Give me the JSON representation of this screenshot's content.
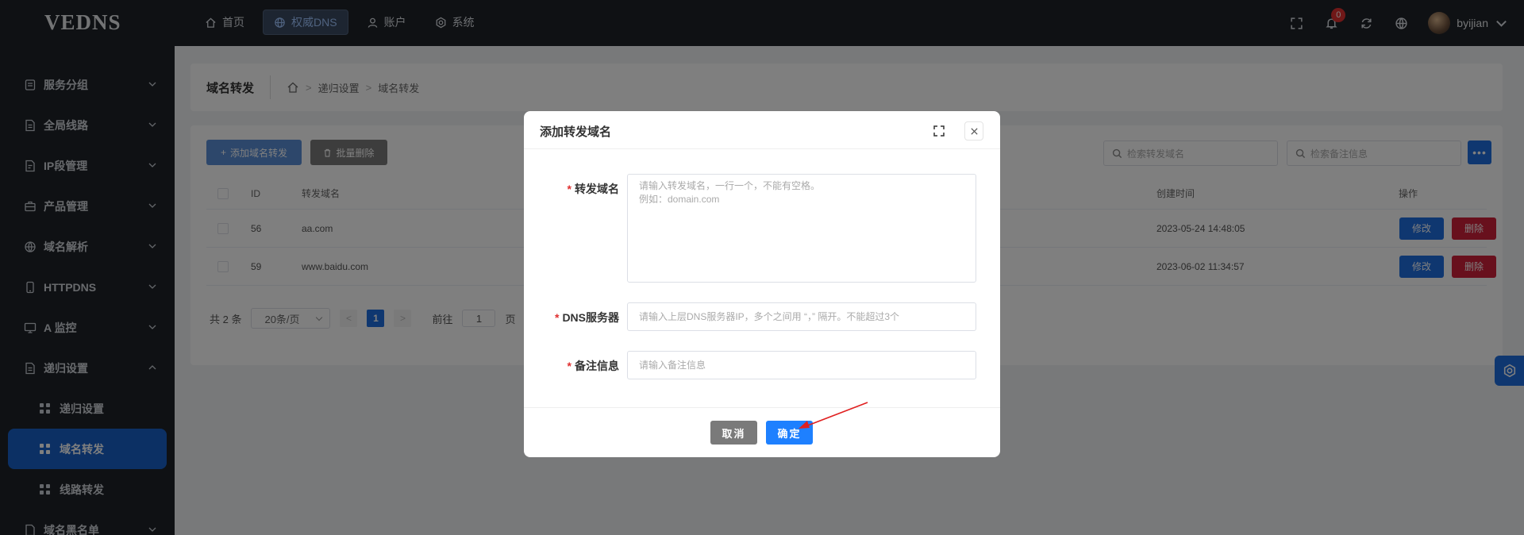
{
  "app": {
    "logo": "VEDNS"
  },
  "topnav": {
    "items": [
      {
        "label": "首页",
        "icon": "home-icon",
        "active": false
      },
      {
        "label": "权威DNS",
        "icon": "globe-icon",
        "active": true
      },
      {
        "label": "账户",
        "icon": "user-icon",
        "active": false
      },
      {
        "label": "系统",
        "icon": "gear-icon",
        "active": false
      }
    ]
  },
  "topright": {
    "notification_count": "0",
    "username": "byijian"
  },
  "sidebar": {
    "items": [
      {
        "label": "服务分组"
      },
      {
        "label": "全局线路"
      },
      {
        "label": "IP段管理"
      },
      {
        "label": "产品管理"
      },
      {
        "label": "域名解析"
      },
      {
        "label": "HTTPDNS"
      },
      {
        "label": "A 监控"
      },
      {
        "label": "递归设置"
      }
    ],
    "sub_items": [
      {
        "label": "递归设置",
        "active": false
      },
      {
        "label": "域名转发",
        "active": true
      },
      {
        "label": "线路转发",
        "active": false
      }
    ],
    "partial_item": "域名黑名单"
  },
  "breadcrumb": {
    "title": "域名转发",
    "path": [
      "递归设置",
      "域名转发"
    ]
  },
  "toolbar": {
    "add_label": "添加域名转发",
    "batch_delete_label": "批量删除",
    "search_domain_placeholder": "检索转发域名",
    "search_remark_placeholder": "检索备注信息",
    "more_label": "•••"
  },
  "table": {
    "columns": [
      "ID",
      "转发域名",
      "创建时间",
      "操作"
    ],
    "rows": [
      {
        "id": "56",
        "domain": "aa.com",
        "created": "2023-05-24 14:48:05",
        "edit": "修改",
        "delete": "删除"
      },
      {
        "id": "59",
        "domain": "www.baidu.com",
        "created": "2023-06-02 11:34:57",
        "edit": "修改",
        "delete": "删除"
      }
    ]
  },
  "pager": {
    "total": "共 2 条",
    "page_size": "20条/页",
    "current_page": "1",
    "goto_label": "前往",
    "goto_value": "1",
    "page_suffix": "页"
  },
  "modal": {
    "title": "添加转发域名",
    "fields": [
      {
        "label": "转发域名",
        "placeholder_line1": "请输入转发域名，一行一个，不能有空格。",
        "placeholder_line2": "例如：domain.com"
      },
      {
        "label": "DNS服务器",
        "placeholder": "请输入上层DNS服务器IP，多个之间用 “，” 隔开。不能超过3个"
      },
      {
        "label": "备注信息",
        "placeholder": "请输入备注信息"
      }
    ],
    "cancel_label": "取消",
    "ok_label": "确定"
  },
  "colors": {
    "primary": "#1e6ee0",
    "danger": "#d0203a",
    "sidebar_bg": "#1f2329",
    "active_item": "#1861c9"
  }
}
